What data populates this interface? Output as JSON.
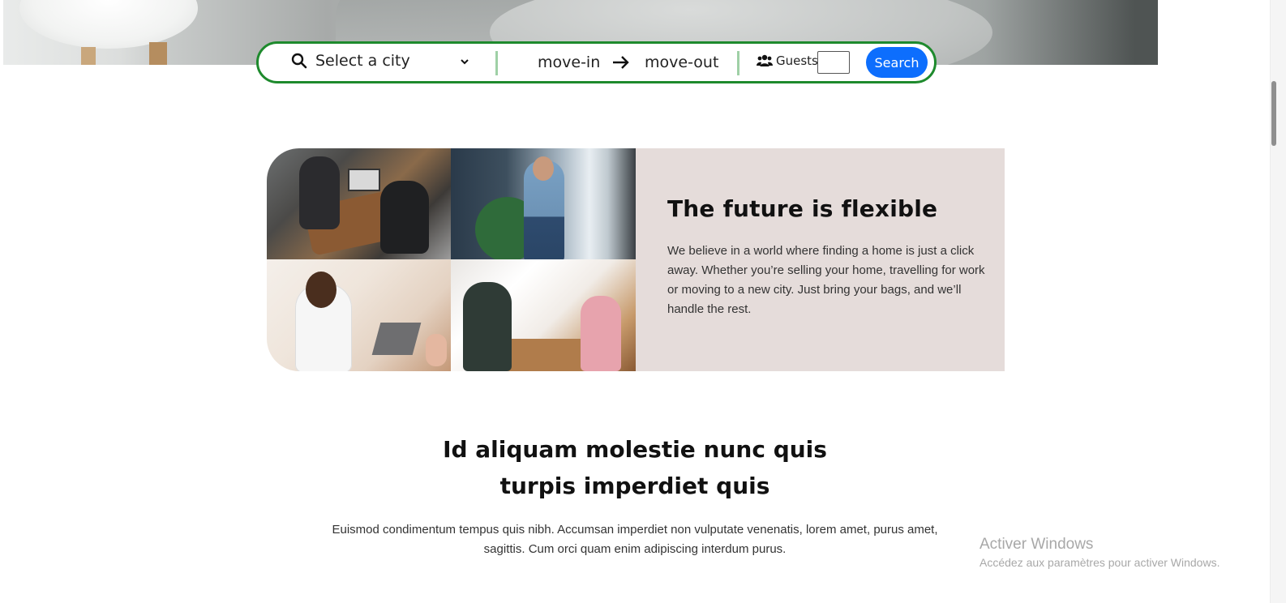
{
  "search": {
    "city_placeholder": "Select a city",
    "move_in": "move-in",
    "move_out": "move-out",
    "guests_label": "Guests",
    "guests_value": "",
    "button_label": "Search",
    "border_color": "#1e8a2d",
    "button_color": "#0d6efd"
  },
  "feature": {
    "title": "The future is flexible",
    "body": "We believe in a world where finding a home is just a click away. Whether you’re selling your home, travelling for work or moving to a new city. Just bring your bags, and we’ll handle the rest.",
    "panel_color": "#e5dcda"
  },
  "section2": {
    "title_line1": "Id aliquam molestie nunc quis",
    "title_line2": "turpis imperdiet quis",
    "body": "Euismod condimentum tempus quis nibh. Accumsan imperdiet non vulputate venenatis, lorem amet, purus amet, sagittis. Cum orci quam enim adipiscing interdum purus."
  },
  "watermark": {
    "title": "Activer Windows",
    "subtitle": "Accédez aux paramètres pour activer Windows."
  },
  "icons": {
    "search": "search-icon",
    "chevron": "chevron-down-icon",
    "arrow": "arrow-right-icon",
    "users": "users-icon"
  }
}
